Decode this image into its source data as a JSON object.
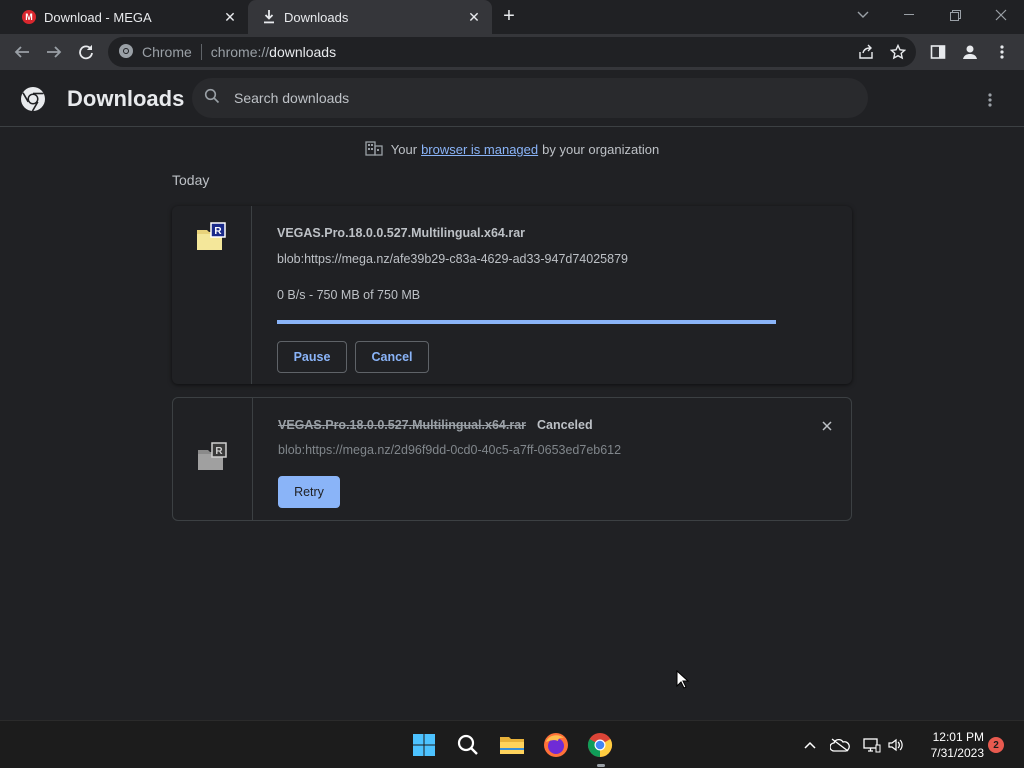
{
  "window": {
    "tabs": [
      {
        "title": "Download - MEGA",
        "favicon": "mega-icon",
        "active": false
      },
      {
        "title": "Downloads",
        "favicon": "download-icon",
        "active": true
      }
    ]
  },
  "toolbar": {
    "site_chip": "Chrome",
    "url_scheme": "chrome://",
    "url_host": "downloads"
  },
  "downloads_page": {
    "title": "Downloads",
    "search_placeholder": "Search downloads",
    "managed_notice": {
      "prefix": "Your",
      "link": "browser is managed",
      "suffix": "by your organization"
    },
    "day_label": "Today",
    "items": [
      {
        "filename": "VEGAS.Pro.18.0.0.527.Multilingual.x64.rar",
        "url": "blob:https://mega.nz/afe39b29-c83a-4629-ad33-947d74025879",
        "progress_text": "0 B/s - 750 MB of 750 MB",
        "progress_percent": 100,
        "buttons": {
          "pause": "Pause",
          "cancel": "Cancel"
        }
      },
      {
        "filename": "VEGAS.Pro.18.0.0.527.Multilingual.x64.rar",
        "status": "Canceled",
        "url": "blob:https://mega.nz/2d96f9dd-0cd0-40c5-a7ff-0653ed7eb612",
        "buttons": {
          "retry": "Retry"
        }
      }
    ]
  },
  "taskbar": {
    "time": "12:01 PM",
    "date": "7/31/2023",
    "notification_count": "2"
  },
  "colors": {
    "accent": "#8ab4f8",
    "background": "#202124",
    "toolbar": "#35363a",
    "taskbar": "#1c1c1c"
  }
}
